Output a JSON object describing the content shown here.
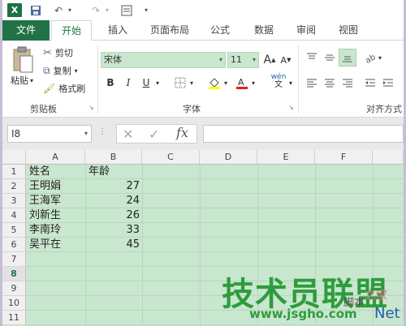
{
  "qat": {
    "excel_icon_letter": "X",
    "save": "💾",
    "undo": "↶",
    "redo": "↷"
  },
  "tabs": [
    "文件",
    "开始",
    "插入",
    "页面布局",
    "公式",
    "数据",
    "审阅",
    "视图"
  ],
  "clipboard": {
    "paste": "粘贴",
    "cut": "剪切",
    "copy": "复制",
    "format_painter": "格式刷",
    "group": "剪贴板"
  },
  "font": {
    "name": "宋体",
    "size": "11",
    "grow": "A",
    "shrink": "A",
    "bold": "B",
    "italic": "I",
    "underline": "U",
    "phonetic": "wén",
    "group": "字体"
  },
  "alignment": {
    "group": "对齐方式"
  },
  "formula_bar": {
    "cell_ref": "I8",
    "fx": "fx",
    "value": ""
  },
  "columns": [
    "A",
    "B",
    "C",
    "D",
    "E",
    "F"
  ],
  "rows": [
    "1",
    "2",
    "3",
    "4",
    "5",
    "6",
    "7",
    "8",
    "9",
    "10",
    "11"
  ],
  "sheet": {
    "header": {
      "name": "姓名",
      "age": "年龄"
    },
    "data": [
      {
        "name": "王明娟",
        "age": "27"
      },
      {
        "name": "王海军",
        "age": "24"
      },
      {
        "name": "刘新生",
        "age": "26"
      },
      {
        "name": "李南玲",
        "age": "33"
      },
      {
        "name": "吴平在",
        "age": "45"
      }
    ]
  },
  "watermark": {
    "main": "技术员联盟",
    "site": "www.jsgho.com",
    "net": "Net",
    "zhi": "之家",
    "alt": "脚本"
  },
  "colors": {
    "excel_green": "#217346",
    "selection_fill": "#c9e6cf",
    "watermark_green": "#2e9c3c"
  }
}
